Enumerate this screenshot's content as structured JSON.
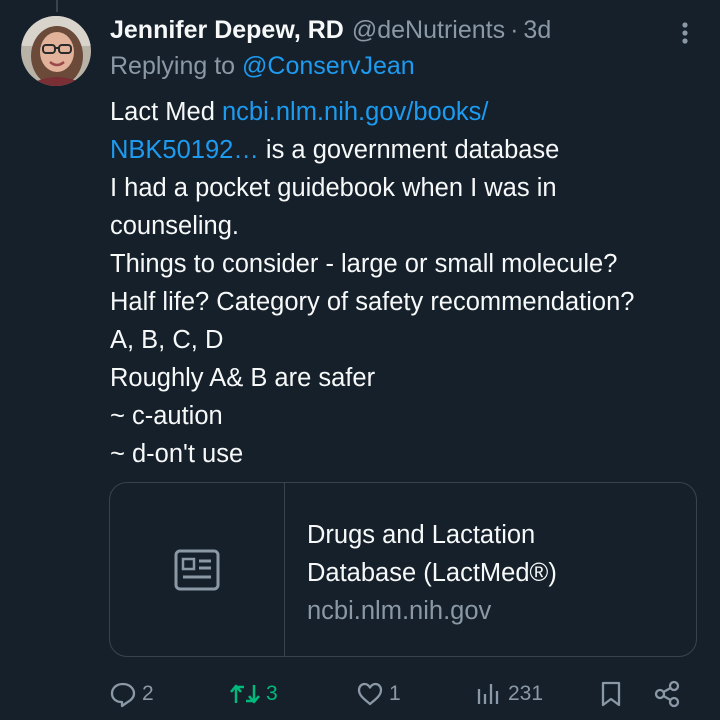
{
  "tweet": {
    "author_name": "Jennifer Depew, RD",
    "handle": "@deNutrients",
    "separator": "·",
    "time": "3d",
    "reply_prefix": "Replying to",
    "reply_mention": "@ConservJean",
    "body": {
      "line1_text": "Lact Med ",
      "line1_link": "ncbi.nlm.nih.gov/books/",
      "line2_link": "NBK50192…",
      "line2_text": " is a government database",
      "lines": [
        "I had a pocket guidebook when I was in",
        "counseling.",
        "Things to consider - large or small molecule?",
        "Half life? Category of safety recommendation?",
        "A, B, C, D",
        "Roughly A& B are safer",
        "~ c-aution",
        "~ d-on't use"
      ]
    },
    "card": {
      "title_line1": "Drugs and Lactation",
      "title_line2": "Database (LactMed®)",
      "domain": "ncbi.nlm.nih.gov",
      "icon": "article-icon"
    },
    "actions": {
      "replies": "2",
      "retweets": "3",
      "likes": "1",
      "views": "231"
    }
  },
  "colors": {
    "background": "#15202b",
    "text": "#f7f9f9",
    "secondary": "#8b98a5",
    "link": "#1d9bf0",
    "retweet_active": "#00ba7c",
    "border": "#38444d"
  },
  "icons": [
    "more-icon",
    "reply-icon",
    "retweet-icon",
    "like-icon",
    "views-icon",
    "bookmark-icon",
    "share-icon",
    "article-icon"
  ]
}
